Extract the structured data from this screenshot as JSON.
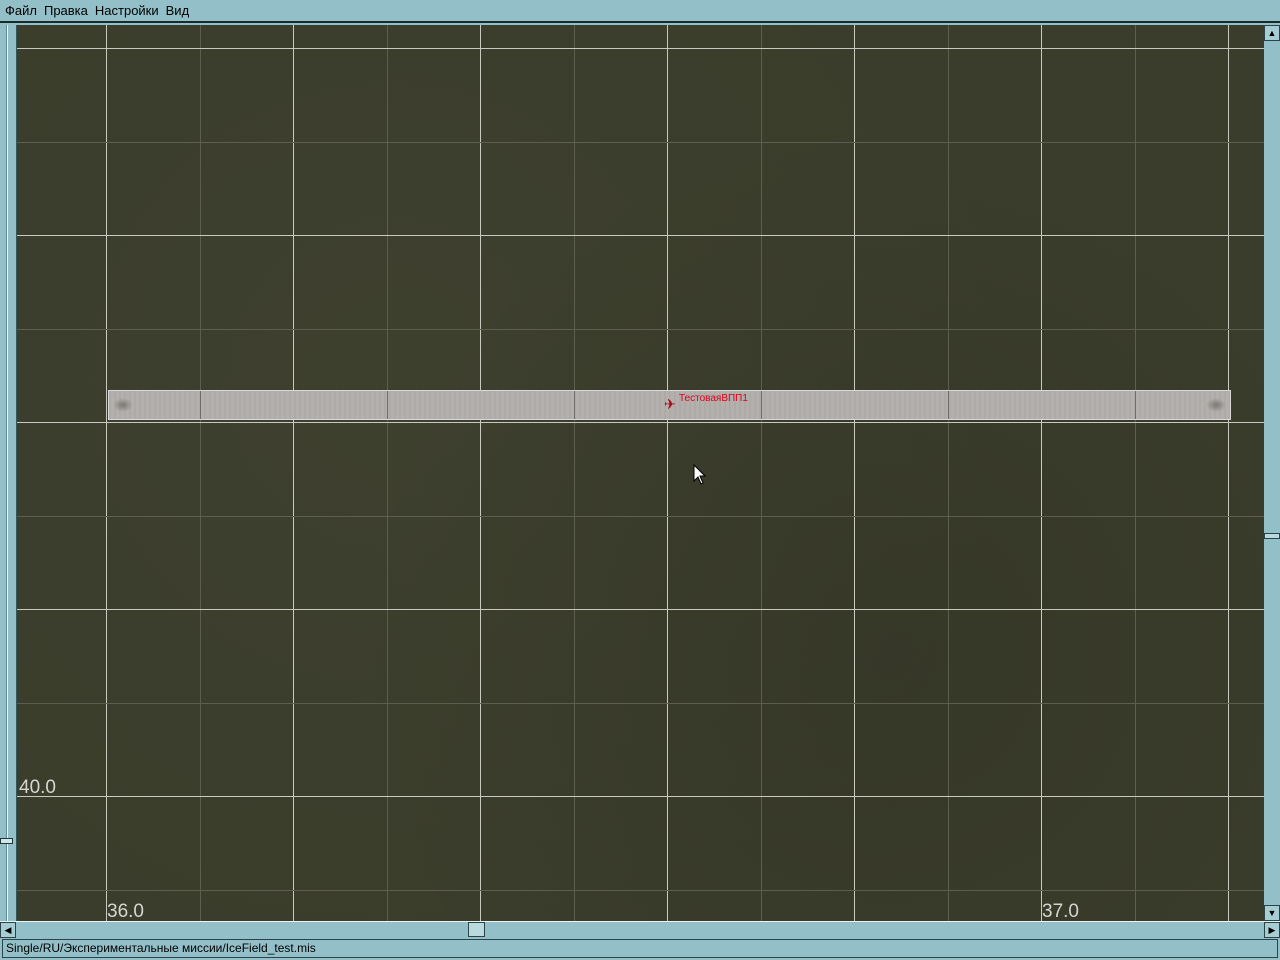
{
  "menu": {
    "items": [
      "Файл",
      "Правка",
      "Настройки",
      "Вид"
    ]
  },
  "map": {
    "runway_label": "ТестоваяВПП1",
    "coord_labels": {
      "y_left": "40.0",
      "x_left": "36.0",
      "x_right": "37.0"
    },
    "runway_label_color": "#e0001a",
    "ground_color": "#3b3d2c"
  },
  "status": {
    "path": "Single/RU/Экспериментальные миссии/IceField_test.mis"
  }
}
